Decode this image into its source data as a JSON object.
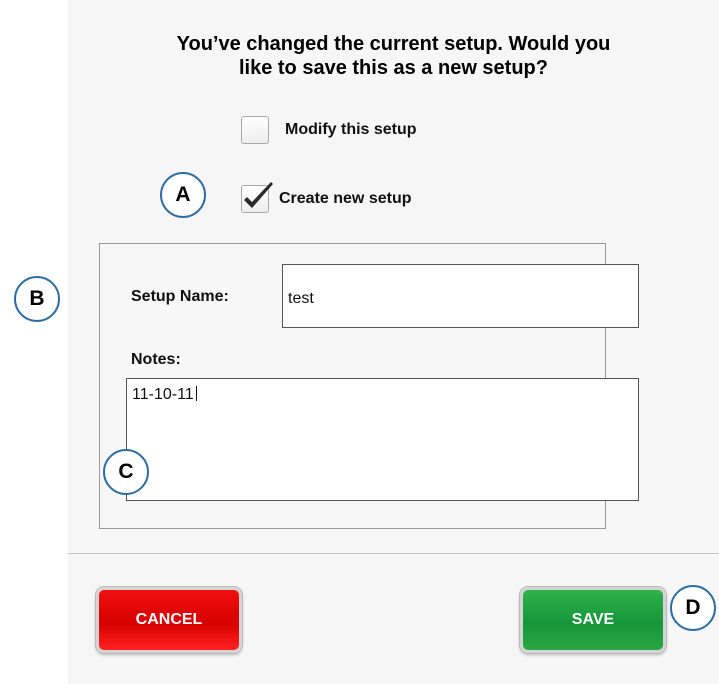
{
  "dialog": {
    "question_line1": "You’ve changed the current setup. Would you",
    "question_line2": "like to save this as a new setup?"
  },
  "options": {
    "modify_label": "Modify this setup",
    "modify_checked": false,
    "create_label": "Create new setup",
    "create_checked": true
  },
  "form": {
    "setup_name_label": "Setup Name:",
    "setup_name_value": "test",
    "notes_label": "Notes:",
    "notes_value": "11-10-11"
  },
  "buttons": {
    "cancel_label": "CANCEL",
    "save_label": "SAVE"
  },
  "callouts": {
    "a": "A",
    "b": "B",
    "c": "C",
    "d": "D"
  },
  "colors": {
    "cancel": "#e00000",
    "save": "#1e9e3e",
    "callout_border": "#2f6ea3"
  }
}
